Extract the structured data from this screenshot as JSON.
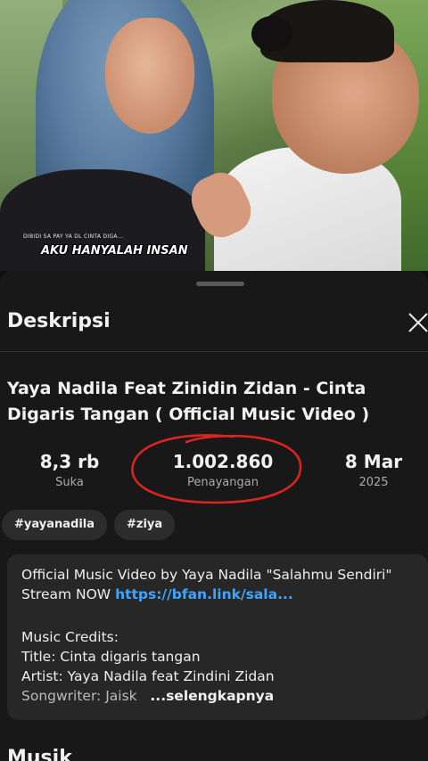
{
  "video": {
    "overlay_small": "DIBIDI SA PAY YA DL  CINTA DIGA...",
    "overlay_title": "AKU HANYALAH INSAN"
  },
  "sheet": {
    "title": "Deskripsi",
    "close_icon": "close-icon",
    "video_title": "Yaya Nadila Feat Zinidin Zidan - Cinta Digaris Tangan ( Official Music Video )",
    "stats": [
      {
        "value": "8,3 rb",
        "label": "Suka"
      },
      {
        "value": "1.002.860",
        "label": "Penayangan"
      },
      {
        "value": "8 Mar",
        "label": "2025"
      }
    ],
    "tags": [
      "#yayanadila",
      "#ziya"
    ],
    "description": {
      "line1": "Official Music Video by Yaya Nadila \"Salahmu Sendiri\"",
      "stream_prefix": "Stream NOW ",
      "stream_link": "https://bfan.link/sala...",
      "credits_heading": "Music Credits:",
      "title_line": "Title: Cinta digaris tangan",
      "artist_line": "Artist: Yaya Nadila feat Zindini Zidan",
      "songwriter_prefix": "Songwriter: Jaisk",
      "more_label": "...selengkapnya"
    },
    "next_section": "Musik"
  },
  "colors": {
    "background": "#0f0f0f",
    "sheet": "#181818",
    "card": "#272727",
    "link": "#3ea6ff",
    "annotation": "#d8251f"
  }
}
